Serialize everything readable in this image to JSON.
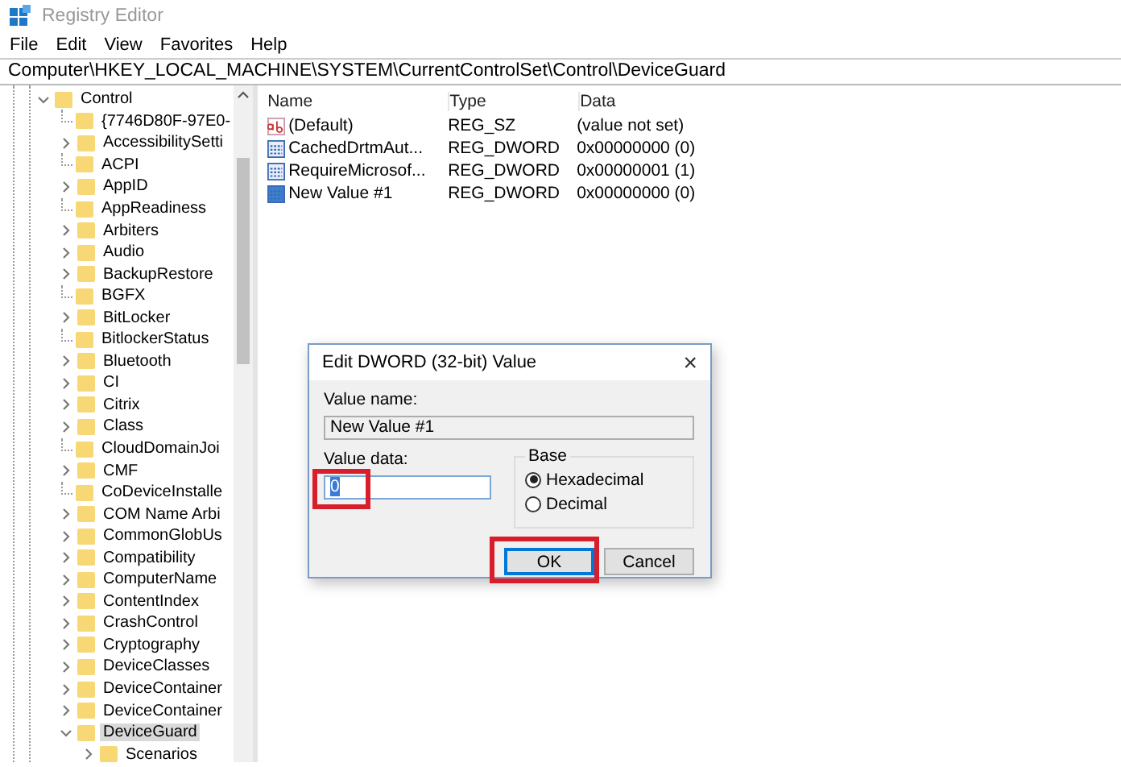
{
  "window": {
    "title": "Registry Editor"
  },
  "menu": [
    "File",
    "Edit",
    "View",
    "Favorites",
    "Help"
  ],
  "address": "Computer\\HKEY_LOCAL_MACHINE\\SYSTEM\\CurrentControlSet\\Control\\DeviceGuard",
  "tree": [
    {
      "label": "Control",
      "expandable": true,
      "expanded": true,
      "selected": false,
      "children": [
        {
          "label": "{7746D80F-97E0-",
          "expandable": false,
          "selected": false
        },
        {
          "label": "AccessibilitySetti",
          "expandable": true,
          "expanded": false,
          "selected": false
        },
        {
          "label": "ACPI",
          "expandable": false,
          "selected": false
        },
        {
          "label": "AppID",
          "expandable": true,
          "expanded": false,
          "selected": false
        },
        {
          "label": "AppReadiness",
          "expandable": false,
          "selected": false
        },
        {
          "label": "Arbiters",
          "expandable": true,
          "expanded": false,
          "selected": false
        },
        {
          "label": "Audio",
          "expandable": true,
          "expanded": false,
          "selected": false
        },
        {
          "label": "BackupRestore",
          "expandable": true,
          "expanded": false,
          "selected": false
        },
        {
          "label": "BGFX",
          "expandable": false,
          "selected": false
        },
        {
          "label": "BitLocker",
          "expandable": true,
          "expanded": false,
          "selected": false
        },
        {
          "label": "BitlockerStatus",
          "expandable": false,
          "selected": false
        },
        {
          "label": "Bluetooth",
          "expandable": true,
          "expanded": false,
          "selected": false
        },
        {
          "label": "CI",
          "expandable": true,
          "expanded": false,
          "selected": false
        },
        {
          "label": "Citrix",
          "expandable": true,
          "expanded": false,
          "selected": false
        },
        {
          "label": "Class",
          "expandable": true,
          "expanded": false,
          "selected": false
        },
        {
          "label": "CloudDomainJoi",
          "expandable": false,
          "selected": false
        },
        {
          "label": "CMF",
          "expandable": true,
          "expanded": false,
          "selected": false
        },
        {
          "label": "CoDeviceInstalle",
          "expandable": false,
          "selected": false
        },
        {
          "label": "COM Name Arbi",
          "expandable": true,
          "expanded": false,
          "selected": false
        },
        {
          "label": "CommonGlobUs",
          "expandable": true,
          "expanded": false,
          "selected": false
        },
        {
          "label": "Compatibility",
          "expandable": true,
          "expanded": false,
          "selected": false
        },
        {
          "label": "ComputerName",
          "expandable": true,
          "expanded": false,
          "selected": false
        },
        {
          "label": "ContentIndex",
          "expandable": true,
          "expanded": false,
          "selected": false
        },
        {
          "label": "CrashControl",
          "expandable": true,
          "expanded": false,
          "selected": false
        },
        {
          "label": "Cryptography",
          "expandable": true,
          "expanded": false,
          "selected": false
        },
        {
          "label": "DeviceClasses",
          "expandable": true,
          "expanded": false,
          "selected": false
        },
        {
          "label": "DeviceContainer",
          "expandable": true,
          "expanded": false,
          "selected": false
        },
        {
          "label": "DeviceContainer",
          "expandable": true,
          "expanded": false,
          "selected": false
        },
        {
          "label": "DeviceGuard",
          "expandable": true,
          "expanded": true,
          "selected": true,
          "children": [
            {
              "label": "Scenarios",
              "expandable": true,
              "expanded": false,
              "selected": false
            }
          ]
        }
      ]
    }
  ],
  "values": {
    "columns": [
      "Name",
      "Type",
      "Data"
    ],
    "rows": [
      {
        "kind": "string",
        "name": "(Default)",
        "type": "REG_SZ",
        "data": "(value not set)",
        "selected": false
      },
      {
        "kind": "binary",
        "name": "CachedDrtmAut...",
        "type": "REG_DWORD",
        "data": "0x00000000 (0)",
        "selected": false
      },
      {
        "kind": "binary",
        "name": "RequireMicrosof...",
        "type": "REG_DWORD",
        "data": "0x00000001 (1)",
        "selected": false
      },
      {
        "kind": "binary",
        "name": "New Value #1",
        "type": "REG_DWORD",
        "data": "0x00000000 (0)",
        "selected": false
      }
    ]
  },
  "dialog": {
    "title": "Edit DWORD (32-bit) Value",
    "close": "×",
    "name_label": "Value name:",
    "name_value": "New Value #1",
    "data_label": "Value data:",
    "data_value": "0",
    "data_highlighted": true,
    "base_label": "Base",
    "radios": [
      {
        "label": "Hexadecimal",
        "selected": true
      },
      {
        "label": "Decimal",
        "selected": false
      }
    ],
    "buttons": [
      {
        "label": "OK",
        "default": true,
        "highlighted": true
      },
      {
        "label": "Cancel",
        "default": false,
        "highlighted": false
      }
    ]
  }
}
